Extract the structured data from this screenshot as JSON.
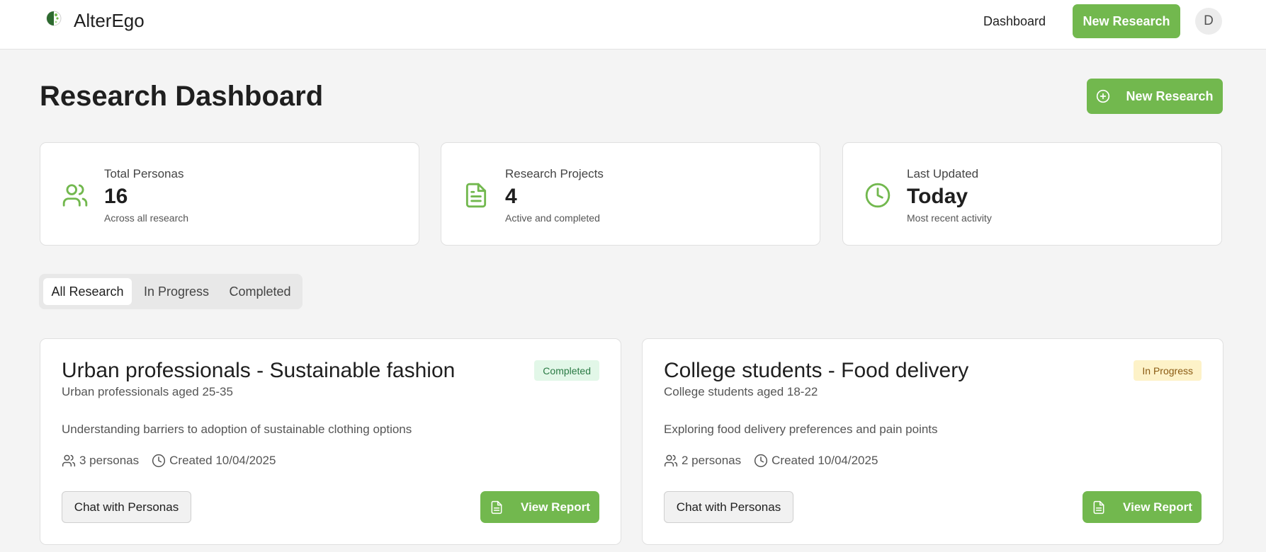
{
  "app": {
    "name": "AlterEgo"
  },
  "nav": {
    "dashboard": "Dashboard",
    "new_research": "New Research",
    "avatar_initial": "D"
  },
  "page": {
    "title": "Research Dashboard",
    "new_research": "New Research"
  },
  "stats": [
    {
      "label": "Total Personas",
      "value": "16",
      "sub": "Across all research",
      "icon": "users-icon"
    },
    {
      "label": "Research Projects",
      "value": "4",
      "sub": "Active and completed",
      "icon": "document-icon"
    },
    {
      "label": "Last Updated",
      "value": "Today",
      "sub": "Most recent activity",
      "icon": "clock-icon"
    }
  ],
  "tabs": [
    "All Research",
    "In Progress",
    "Completed"
  ],
  "active_tab": "All Research",
  "projects": [
    {
      "title": "Urban professionals - Sustainable fashion",
      "audience": "Urban professionals aged 25-35",
      "status": "Completed",
      "description": "Understanding barriers to adoption of sustainable clothing options",
      "personas": "3 personas",
      "created": "Created 10/04/2025",
      "chat_label": "Chat with Personas",
      "report_label": "View Report"
    },
    {
      "title": "College students - Food delivery",
      "audience": "College students aged 18-22",
      "status": "In Progress",
      "description": "Exploring food delivery preferences and pain points",
      "personas": "2 personas",
      "created": "Created 10/04/2025",
      "chat_label": "Chat with Personas",
      "report_label": "View Report"
    }
  ],
  "colors": {
    "accent": "#72b84e",
    "completed_bg": "#e2f7e8",
    "completed_text": "#2a7a44",
    "inprogress_bg": "#fdf2c8",
    "inprogress_text": "#8a5a12"
  }
}
